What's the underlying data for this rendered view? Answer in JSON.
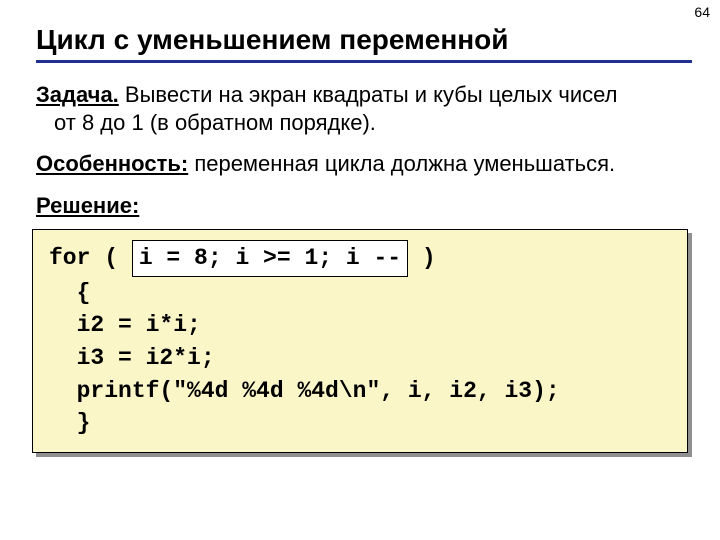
{
  "page_number": "64",
  "title": "Цикл с уменьшением переменной",
  "task_label": "Задача.",
  "task_text_line1": " Вывести на экран квадраты и кубы целых чисел",
  "task_text_line2": "от 8 до 1 (в обратном порядке).",
  "feature_label": "Особенность:",
  "feature_text": " переменная цикла должна уменьшаться.",
  "solution_label": "Решение:",
  "code": {
    "for_kw": "for ( ",
    "highlight": "i = 8; i >= 1; i --",
    "for_end": " )",
    "l2": "  {",
    "l3": "  i2 = i*i;",
    "l4": "  i3 = i2*i;",
    "l5": "  printf(\"%4d %4d %4d\\n\", i, i2, i3);",
    "l6": "  }"
  }
}
